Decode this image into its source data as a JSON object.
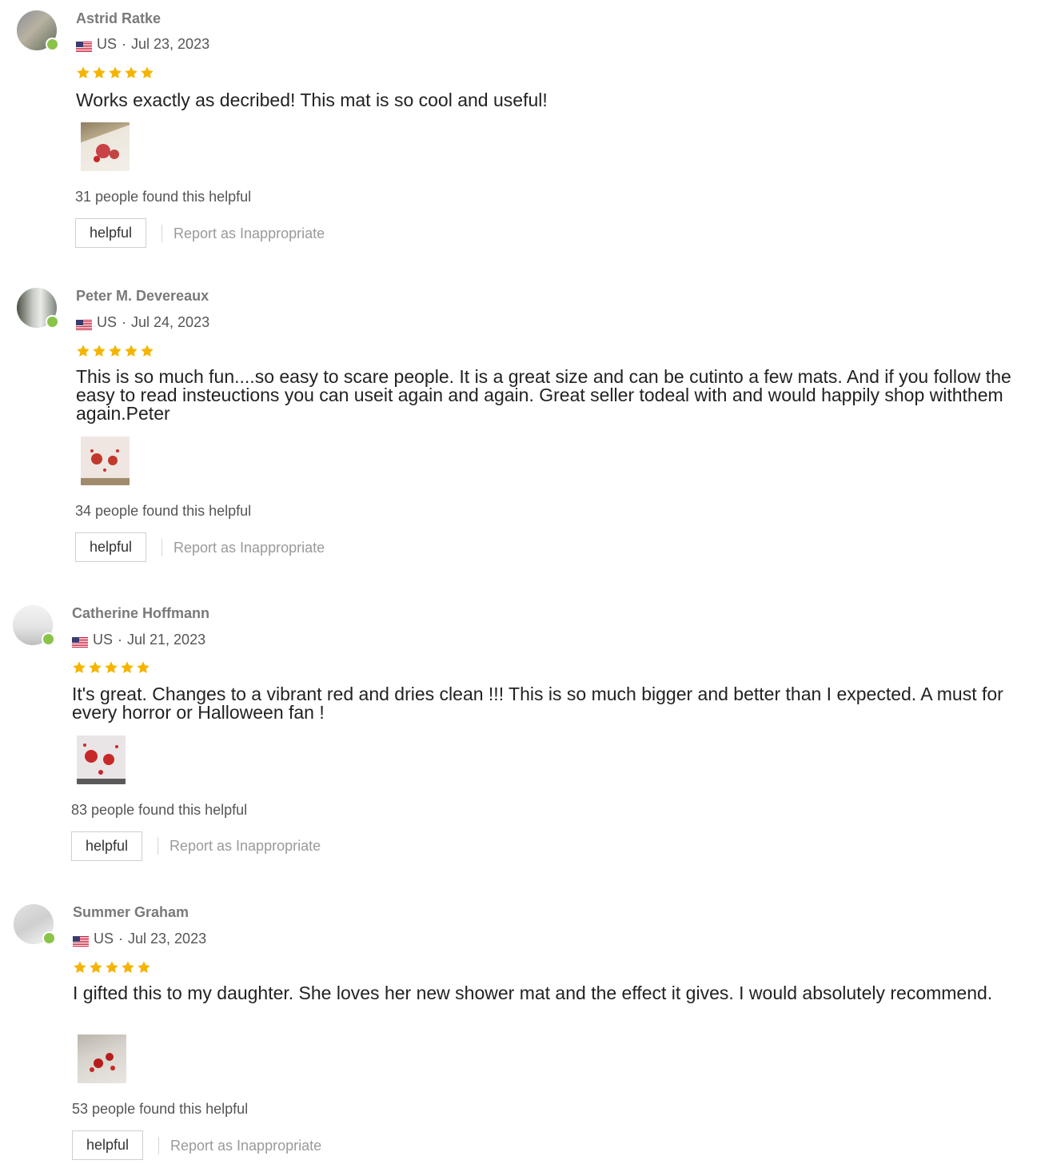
{
  "colors": {
    "star": "#f5b400",
    "verified": "#8bc34a",
    "name": "#7a7a7a"
  },
  "reviews": [
    {
      "name": "Astrid Ratke",
      "country": "US",
      "separator": "·",
      "date": "Jul 23, 2023",
      "rating": 5,
      "text": "Works exactly as decribed! This mat is so cool and useful!",
      "helpful_count": "31 people found this helpful",
      "helpful_label": "helpful",
      "report_label": "Report as Inappropriate"
    },
    {
      "name": "Peter M. Devereaux",
      "country": "US",
      "separator": "·",
      "date": "Jul 24, 2023",
      "rating": 5,
      "text": "This is so much fun....so easy to scare people. It is a great size and can be cutinto a few mats. And if you follow the easy to read insteuctions you can useit again and again. Great seller todeal with and would happily shop withthem again.Peter",
      "helpful_count": "34 people found this helpful",
      "helpful_label": "helpful",
      "report_label": "Report as Inappropriate"
    },
    {
      "name": "Catherine Hoffmann",
      "country": "US",
      "separator": "·",
      "date": "Jul 21, 2023",
      "rating": 5,
      "text": "It's great. Changes to a vibrant red and dries clean !!! This is so much bigger and better than I expected. A must for every horror or Halloween fan !",
      "helpful_count": "83 people found this helpful",
      "helpful_label": "helpful",
      "report_label": "Report as Inappropriate"
    },
    {
      "name": "Summer Graham",
      "country": "US",
      "separator": "·",
      "date": "Jul 23, 2023",
      "rating": 5,
      "text": "I gifted this to my daughter. She loves her new shower mat and the effect it gives. I would absolutely recommend.",
      "helpful_count": "53 people found this helpful",
      "helpful_label": "helpful",
      "report_label": "Report as Inappropriate"
    }
  ]
}
